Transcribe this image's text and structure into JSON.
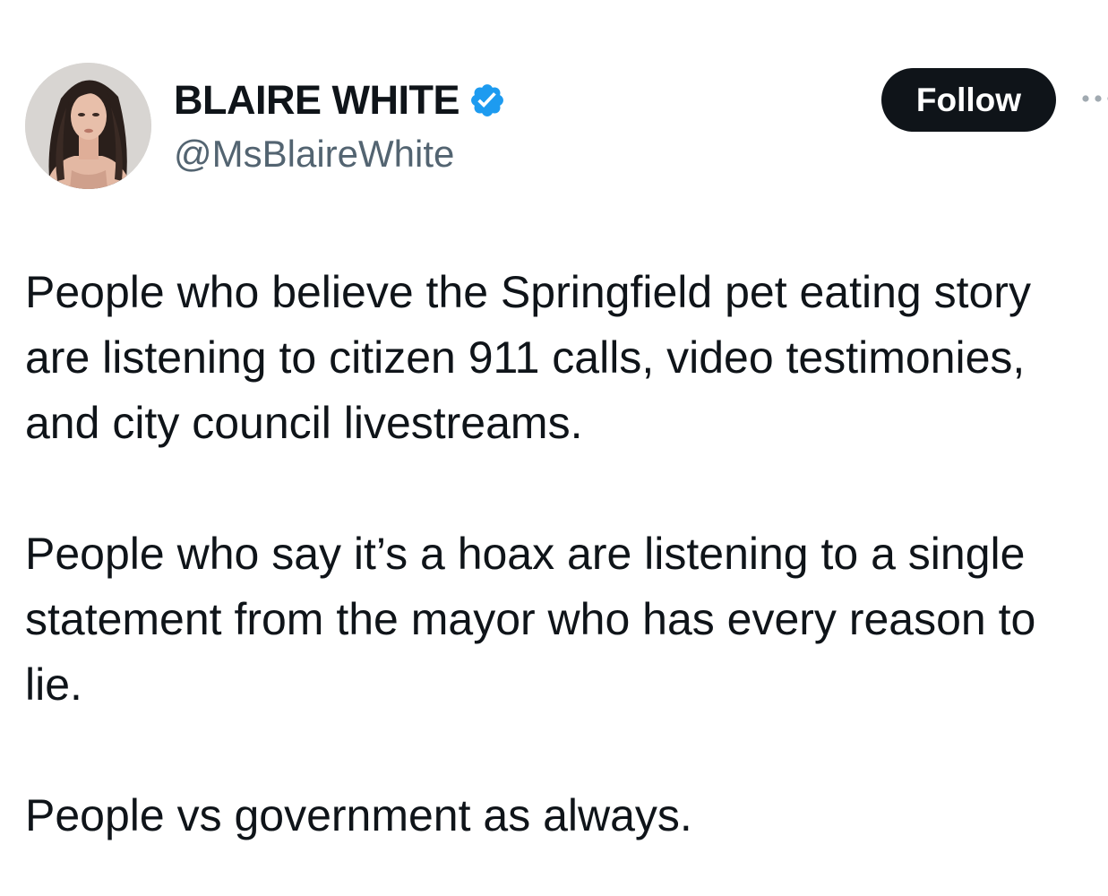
{
  "author": {
    "display_name": "BLAIRE WHITE",
    "handle": "@MsBlaireWhite",
    "verified": true,
    "verified_icon": "verified-badge-icon",
    "verified_color": "#1d9bf0",
    "avatar": "profile-photo"
  },
  "actions": {
    "follow_label": "Follow",
    "more_icon": "more-options-icon"
  },
  "tweet": {
    "lines": [
      "People who believe the Springfield pet eating story",
      "are listening to citizen 911 calls, video testimonies,",
      "and city council livestreams.",
      "",
      "People who say it’s a hoax are listening to a single",
      "statement from the mayor who has every reason to",
      "lie.",
      "",
      "People vs government as always."
    ]
  },
  "colors": {
    "text_primary": "#0f1419",
    "text_secondary": "#536471",
    "follow_bg": "#0f1419",
    "follow_text": "#ffffff"
  }
}
